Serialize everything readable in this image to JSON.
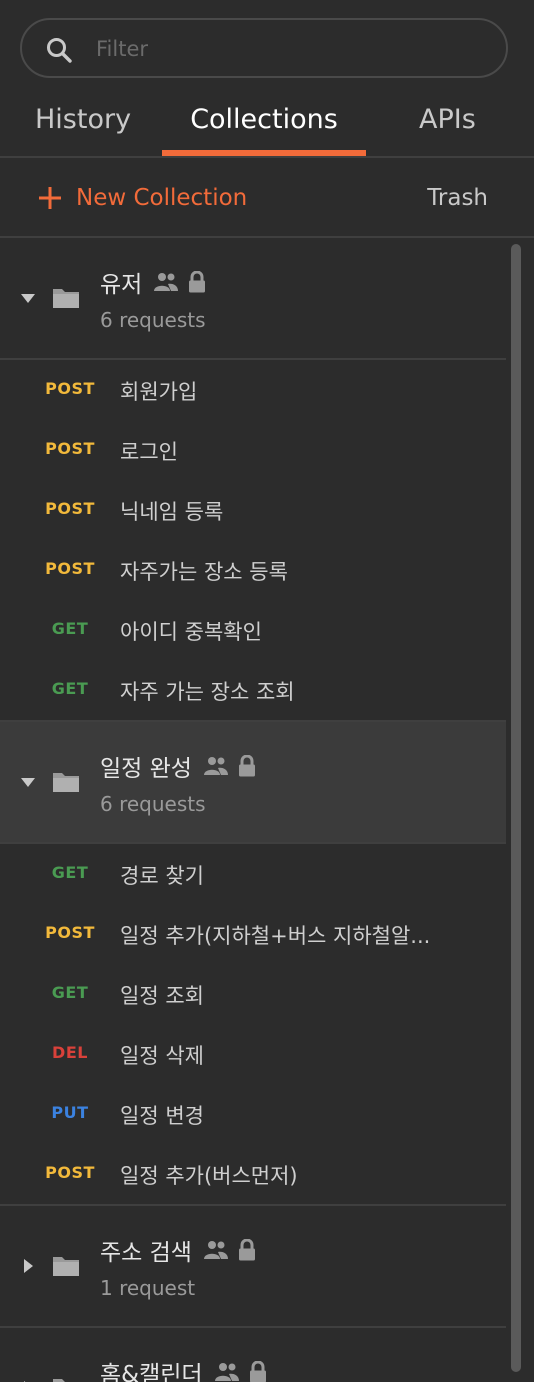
{
  "search": {
    "placeholder": "Filter",
    "value": ""
  },
  "tabs": [
    {
      "label": "History"
    },
    {
      "label": "Collections"
    },
    {
      "label": "APIs"
    }
  ],
  "actions": {
    "new_collection": "New Collection",
    "trash": "Trash"
  },
  "colors": {
    "accent": "#f26b3a",
    "post": "#f2b93b",
    "get": "#4a9b52",
    "del": "#d9413a",
    "put": "#3b82e0"
  },
  "collections": [
    {
      "name": "유저",
      "count": "6 requests",
      "expanded": true,
      "requests": [
        {
          "method": "POST",
          "name": "회원가입"
        },
        {
          "method": "POST",
          "name": "로그인"
        },
        {
          "method": "POST",
          "name": "닉네임 등록"
        },
        {
          "method": "POST",
          "name": "자주가는 장소 등록"
        },
        {
          "method": "GET",
          "name": "아이디 중복확인"
        },
        {
          "method": "GET",
          "name": "자주 가는 장소 조회"
        }
      ]
    },
    {
      "name": "일정 완성",
      "count": "6 requests",
      "expanded": true,
      "requests": [
        {
          "method": "GET",
          "name": "경로 찾기"
        },
        {
          "method": "POST",
          "name": "일정 추가(지하철+버스 지하철알..."
        },
        {
          "method": "GET",
          "name": "일정 조회"
        },
        {
          "method": "DEL",
          "name": "일정 삭제"
        },
        {
          "method": "PUT",
          "name": "일정 변경"
        },
        {
          "method": "POST",
          "name": "일정 추가(버스먼저)"
        }
      ]
    },
    {
      "name": "주소 검색",
      "count": "1 request",
      "expanded": false,
      "requests": []
    },
    {
      "name": "홈&캘린더",
      "count": "",
      "expanded": false,
      "requests": []
    }
  ]
}
